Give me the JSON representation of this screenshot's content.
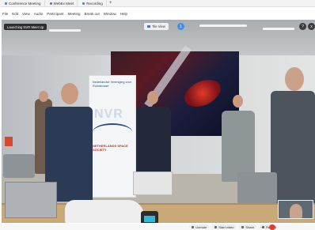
{
  "tabs": [
    {
      "label": "Conference Meeting"
    },
    {
      "label": "WebEx Meet"
    },
    {
      "label": "Recording"
    }
  ],
  "menu": [
    "File",
    "Edit",
    "View",
    "Audio",
    "Participant",
    "Meeting",
    "Break out",
    "Window",
    "Help"
  ],
  "video": {
    "host_badge": "Launching NVR Meet Up",
    "view_button": "Tile View",
    "view_badge": "1",
    "help_icon": "?",
    "close_icon": "x"
  },
  "banner": {
    "top_text": "Nederlandse Vereniging voor Ruimtevaart",
    "logo": "NVR",
    "bottom_text": "NETHERLANDS SPACE SOCIETY"
  },
  "toolbar": {
    "mute": "Unmute",
    "video": "Start video",
    "share": "Share",
    "record": "Record",
    "more": "..."
  },
  "colors": {
    "accent": "#3d8ff0",
    "leave": "#e23a2c"
  }
}
